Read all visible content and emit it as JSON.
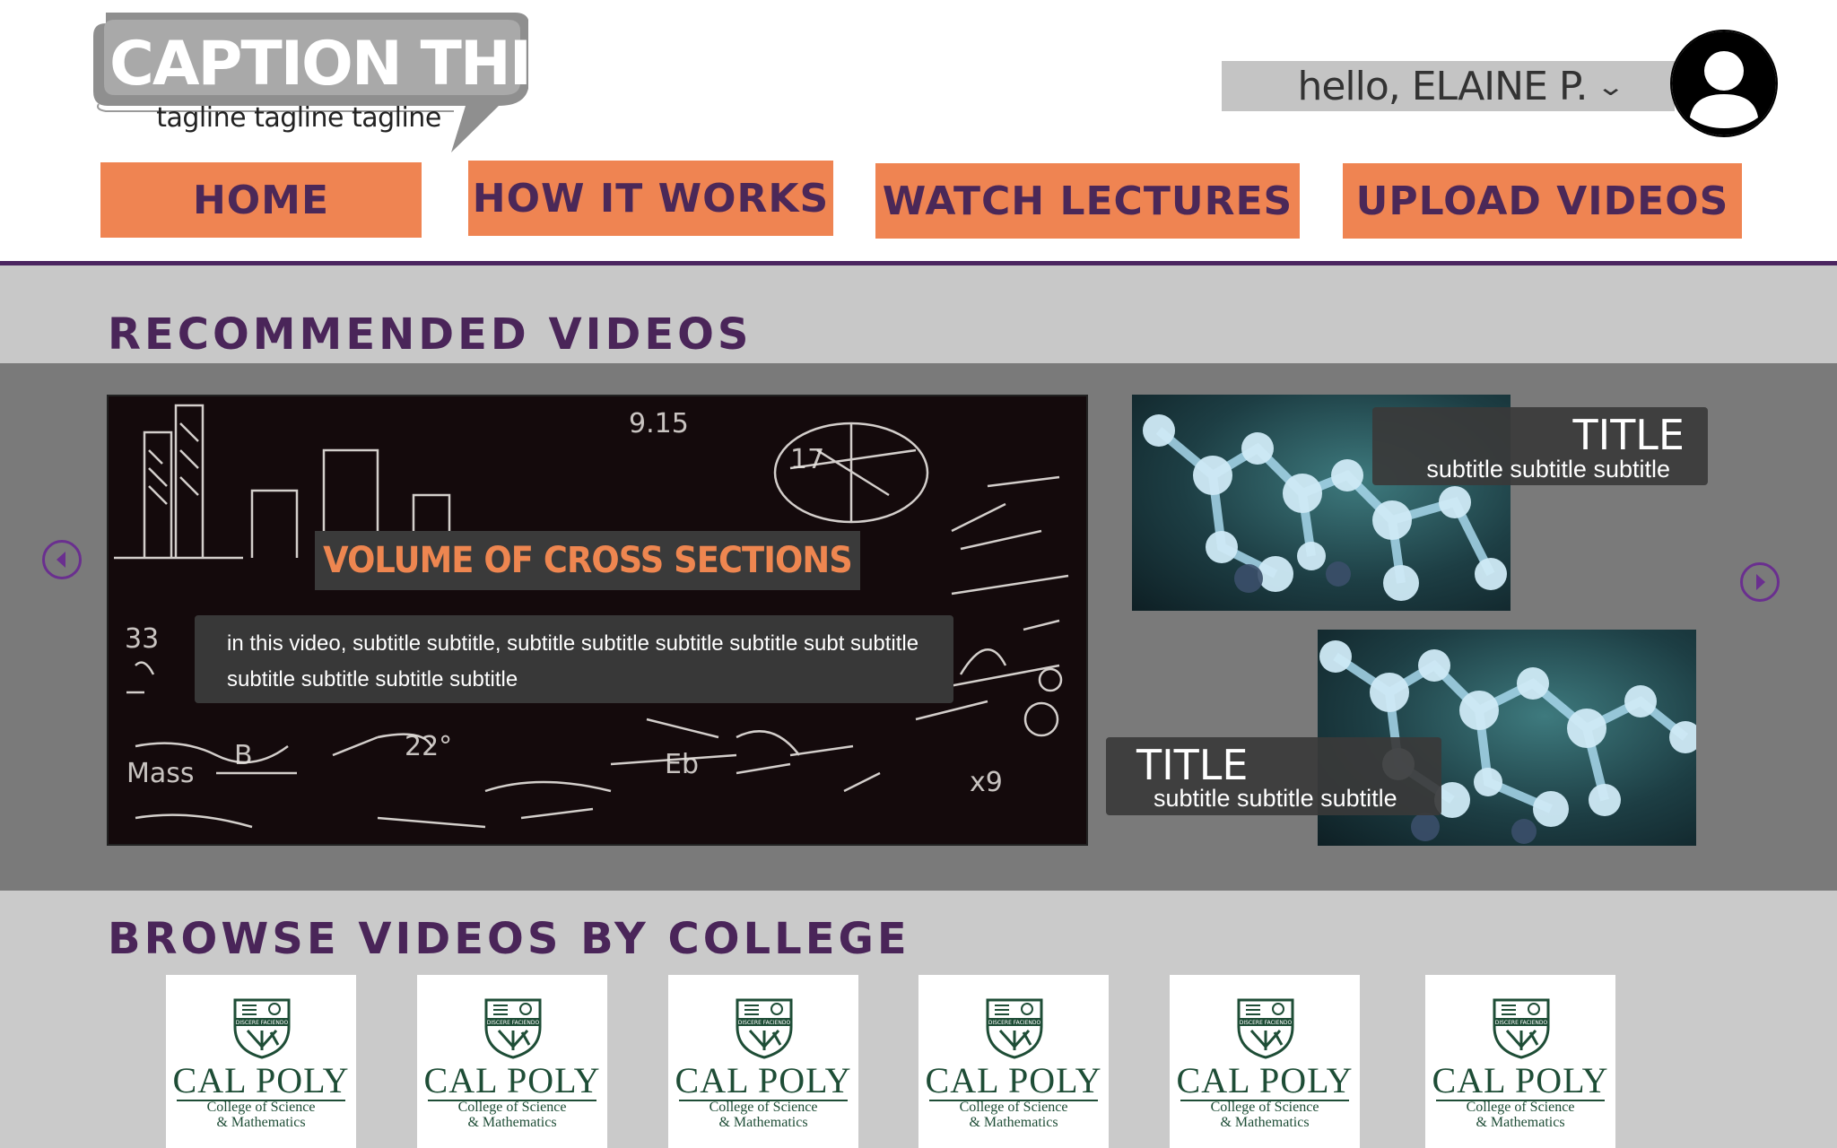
{
  "logo": {
    "title": "CAPTION THIS !",
    "tagline": "tagline tagline tagline"
  },
  "user": {
    "greeting": "hello, ELAINE P.",
    "chevron_icon": "chevron-down-icon",
    "avatar_icon": "user-avatar-icon"
  },
  "nav": {
    "home": "HOME",
    "how_it_works": "HOW IT WORKS",
    "watch_lectures": "WATCH LECTURES",
    "upload_videos": "UPLOAD VIDEOS"
  },
  "recommended": {
    "heading": "RECOMMENDED VIDEOS",
    "featured": {
      "title": "VOLUME OF CROSS SECTIONS",
      "description": "in this video, subtitle subtitle, subtitle subtitle subtitle subtitle subt subtitle subtitle subtitle subtitle subtitle"
    },
    "side_videos": [
      {
        "title": "TITLE",
        "subtitle": "subtitle subtitle subtitle"
      },
      {
        "title": "TITLE",
        "subtitle": "subtitle subtitle subtitle"
      }
    ],
    "prev_icon": "chevron-left-circle-icon",
    "next_icon": "chevron-right-circle-icon"
  },
  "browse": {
    "heading": "BROWSE VIDEOS BY COLLEGE",
    "colleges": [
      {
        "name": "CAL POLY",
        "line1": "College of Science",
        "line2": "& Mathematics",
        "motto": "DISCERE FACIENDO"
      },
      {
        "name": "CAL POLY",
        "line1": "College of Science",
        "line2": "& Mathematics",
        "motto": "DISCERE FACIENDO"
      },
      {
        "name": "CAL POLY",
        "line1": "College of Science",
        "line2": "& Mathematics",
        "motto": "DISCERE FACIENDO"
      },
      {
        "name": "CAL POLY",
        "line1": "College of Science",
        "line2": "& Mathematics",
        "motto": "DISCERE FACIENDO"
      },
      {
        "name": "CAL POLY",
        "line1": "College of Science",
        "line2": "& Mathematics",
        "motto": "DISCERE FACIENDO"
      },
      {
        "name": "CAL POLY",
        "line1": "College of Science",
        "line2": "& Mathematics",
        "motto": "DISCERE FACIENDO"
      }
    ]
  },
  "colors": {
    "accent_orange": "#ef8452",
    "brand_purple": "#4a2559",
    "carousel_gray": "#7a7a7a",
    "band_gray": "#c8c8c8",
    "calpoly_green": "#1e4d36"
  }
}
